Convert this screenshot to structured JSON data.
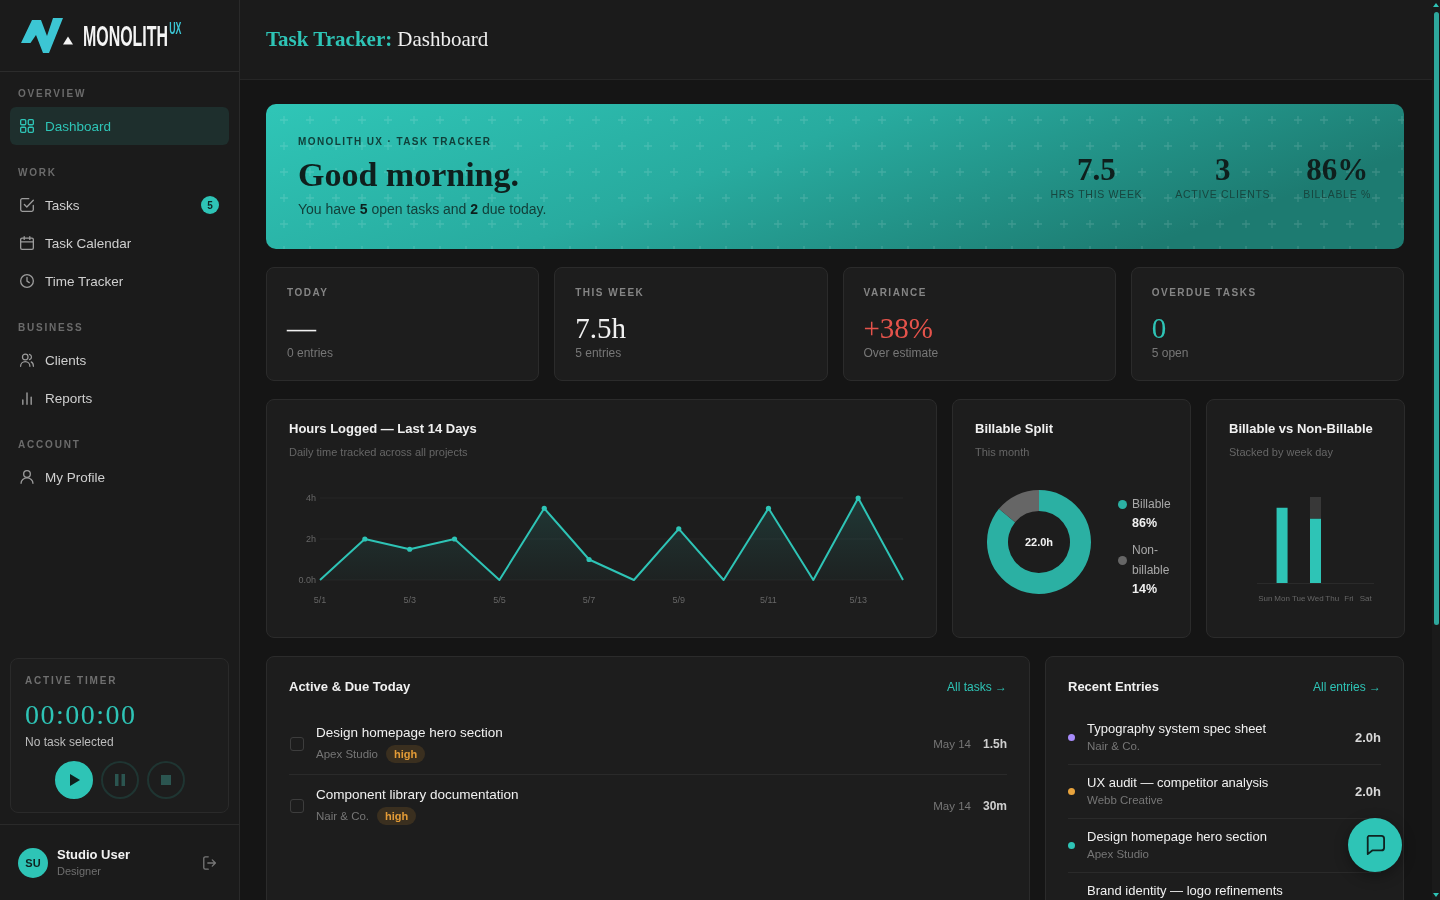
{
  "sidebar": {
    "logo": {
      "wordmark": "MONOLITH",
      "superscript": "UX"
    },
    "sections": [
      {
        "label": "OVERVIEW",
        "items": [
          {
            "kind": "dashboard",
            "label": "Dashboard",
            "selected": true
          }
        ]
      },
      {
        "label": "WORK",
        "items": [
          {
            "kind": "tasks",
            "label": "Tasks",
            "selected": false,
            "badge": "5"
          },
          {
            "kind": "calendar",
            "label": "Task Calendar",
            "selected": false
          },
          {
            "kind": "clock",
            "label": "Time Tracker",
            "selected": false
          }
        ]
      },
      {
        "label": "BUSINESS",
        "items": [
          {
            "kind": "clients",
            "label": "Clients",
            "selected": false
          },
          {
            "kind": "reports",
            "label": "Reports",
            "selected": false
          }
        ]
      },
      {
        "label": "ACCOUNT",
        "items": [
          {
            "kind": "profile",
            "label": "My Profile",
            "selected": false
          }
        ]
      }
    ],
    "active_timer": {
      "label": "ACTIVE TIMER",
      "time": "00:00:00",
      "task": "No task selected",
      "controls": [
        {
          "kind": "play",
          "disabled": false
        },
        {
          "kind": "pause",
          "disabled": true
        },
        {
          "kind": "stop",
          "disabled": true
        }
      ]
    },
    "user": {
      "initials": "SU",
      "name": "Studio User",
      "role": "Designer"
    }
  },
  "header": {
    "title_prefix": "Task Tracker:",
    "title": "Dashboard"
  },
  "hero": {
    "eyebrow": "MONOLITH UX · TASK TRACKER",
    "greeting": "Good morning.",
    "summary": "You have **5** open tasks and **2** due today.",
    "stats": [
      {
        "value": "7.5",
        "label": "HRS THIS WEEK"
      },
      {
        "value": "3",
        "label": "ACTIVE CLIENTS"
      },
      {
        "value": "86%",
        "label": "BILLABLE %"
      }
    ]
  },
  "stat_cards": [
    {
      "label": "TODAY",
      "value": "—",
      "note": "0 entries",
      "color": "#f0f0f0"
    },
    {
      "label": "THIS WEEK",
      "value": "7.5h",
      "note": "5 entries",
      "color": "#f0f0f0"
    },
    {
      "label": "VARIANCE",
      "value": "+38%",
      "note": "Over estimate",
      "color": "#e5534b"
    },
    {
      "label": "OVERDUE TASKS",
      "value": "0",
      "note": "5 open",
      "color": "#2ec4b6"
    }
  ],
  "hours_chart": {
    "subtitle": "Daily time tracked across all projects",
    "chart_data": {
      "type": "line",
      "title": "Hours Logged — Last 14 Days",
      "categories": [
        "5/1",
        null,
        "5/3",
        null,
        "5/5",
        null,
        "5/7",
        null,
        "5/9",
        null,
        "5/11",
        null,
        "5/13",
        null
      ],
      "values": [
        0,
        2,
        1.5,
        2,
        0,
        3.5,
        1,
        0,
        2.5,
        0,
        3.5,
        0,
        4,
        0
      ],
      "ylim": [
        0,
        4
      ],
      "yticks": [
        {
          "value": 0,
          "label": "0.0h"
        },
        {
          "value": 2,
          "label": "2h"
        },
        {
          "value": 4,
          "label": "4h"
        }
      ]
    }
  },
  "split_chart": {
    "subtitle": "This month",
    "center_label": "22.0h",
    "chart_data": {
      "type": "donut",
      "title": "Billable Split",
      "categories": [
        "Billable",
        "Non-billable"
      ],
      "values": [
        86,
        14
      ],
      "colors": [
        "#2bb0a3",
        "#666666"
      ],
      "value_labels": [
        "86%",
        "14%"
      ],
      "legend": "right"
    }
  },
  "weekday_chart": {
    "subtitle": "Stacked by week day",
    "chart_data": {
      "type": "bar",
      "title": "Billable vs Non-Billable",
      "categories": [
        "Sun",
        "Mon",
        "Tue",
        "Wed",
        "Thu",
        "Fri",
        "Sat"
      ],
      "stacked": true,
      "ylim": [
        0,
        4
      ],
      "series": [
        {
          "color": "#2ec4b6",
          "values": [
            0,
            3.5,
            0,
            3,
            0,
            0,
            0
          ]
        },
        {
          "color": "#383838",
          "values": [
            0,
            0,
            0,
            1,
            0,
            0,
            0
          ]
        }
      ]
    }
  },
  "tasks_panel": {
    "title": "Active & Due Today",
    "link": "All tasks →",
    "tasks": [
      {
        "title": "Design homepage hero section",
        "client": "Apex Studio",
        "priority": "high",
        "date": "May 14",
        "duration": "1.5h",
        "checked": false
      },
      {
        "title": "Component library documentation",
        "client": "Nair & Co.",
        "priority": "high",
        "date": "May 14",
        "duration": "30m",
        "checked": false
      }
    ]
  },
  "entries_panel": {
    "title": "Recent Entries",
    "link": "All entries →",
    "entries": [
      {
        "title": "Typography system spec sheet",
        "client": "Nair & Co.",
        "hours": "2.0h",
        "color": "#a78bfa"
      },
      {
        "title": "UX audit — competitor analysis",
        "client": "Webb Creative",
        "hours": "2.0h",
        "color": "#e8a33d"
      },
      {
        "title": "Design homepage hero section",
        "client": "Apex Studio",
        "color": "#2ec4b6"
      },
      {
        "title": "Brand identity — logo refinements"
      }
    ]
  }
}
